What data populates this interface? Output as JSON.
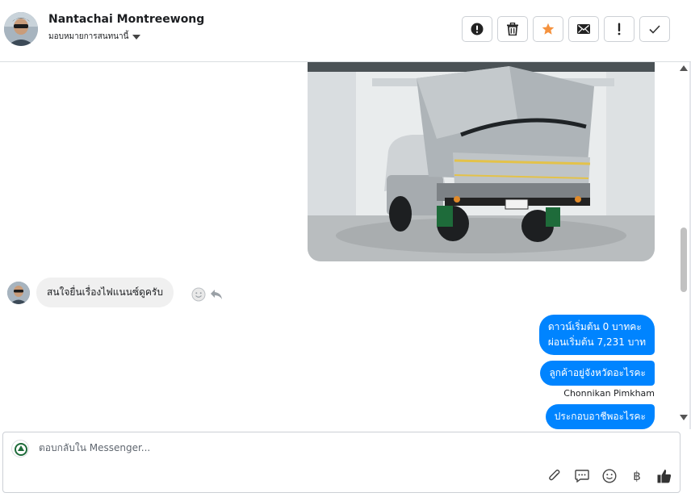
{
  "header": {
    "contact_name": "Nantachai Montreewong",
    "assign_label": "มอบหมายการสนทนานี้",
    "actions": [
      {
        "name": "report-spam-button",
        "icon": "exclamation-circle-icon"
      },
      {
        "name": "delete-button",
        "icon": "trash-icon"
      },
      {
        "name": "star-button",
        "icon": "star-icon",
        "color": "#f5923e"
      },
      {
        "name": "mark-unread-button",
        "icon": "envelope-icon"
      },
      {
        "name": "mark-important-button",
        "icon": "exclamation-icon"
      },
      {
        "name": "mark-done-button",
        "icon": "check-icon"
      }
    ]
  },
  "thread": {
    "incoming_message": "สนใจยื่นเรื่องไฟแนนซ์ดูครับ",
    "outgoing_messages": [
      {
        "line1": "ดาวน์เริ่มต้น 0 บาทคะ",
        "line2": "ผ่อนเริ่มต้น 7,231 บาท"
      },
      {
        "line1": "ลูกค้าอยู่จังหวัดอะไรคะ"
      },
      {
        "line1": "ประกอบอาชีพอะไรคะ"
      }
    ],
    "sender_name": "Chonnikan Pimkham",
    "bubble_color": "#0084ff",
    "photo_alt": "truck-photo"
  },
  "composer": {
    "placeholder": "ตอบกลับใน Messenger...",
    "tools": [
      "paperclip-icon",
      "saved-reply-icon",
      "emoji-icon",
      "baht-icon",
      "like-icon"
    ],
    "currency_symbol": "฿"
  }
}
